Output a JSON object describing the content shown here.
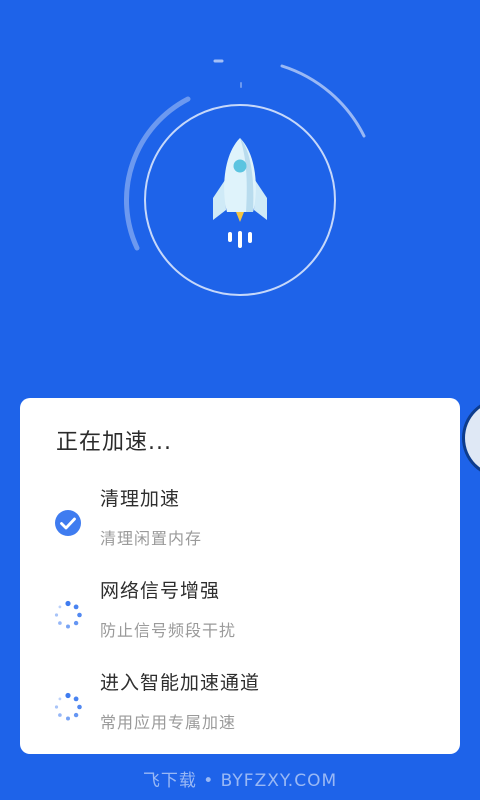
{
  "progress": {
    "title": "正在加速...",
    "steps": [
      {
        "title": "清理加速",
        "subtitle": "清理闲置内存",
        "status": "done",
        "icon": "check-circle-icon"
      },
      {
        "title": "网络信号增强",
        "subtitle": "防止信号频段干扰",
        "status": "in-progress",
        "icon": "loading-spinner-icon"
      },
      {
        "title": "进入智能加速通道",
        "subtitle": "常用应用专属加速",
        "status": "in-progress",
        "icon": "loading-spinner-icon"
      }
    ]
  },
  "colors": {
    "background": "#1e63e9",
    "accent": "#3f7cf0",
    "card": "#ffffff"
  },
  "hero": {
    "icon": "rocket-icon"
  },
  "watermark": "飞下载 • BYFZXY.COM"
}
